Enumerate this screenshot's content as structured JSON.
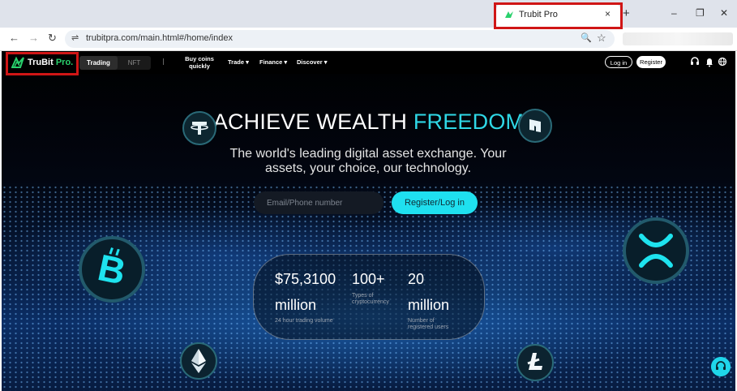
{
  "browser": {
    "tab_title": "Trubit Pro",
    "tab_close": "×",
    "new_tab": "+",
    "window_controls": {
      "minimize": "–",
      "restore": "❐",
      "close": "✕"
    },
    "nav": {
      "back": "←",
      "forward": "→",
      "reload": "↻"
    },
    "url": "trubitpra.com/main.html#/home/index",
    "site_info_icon": "⇌",
    "zoom_icon": "🔍",
    "bookmark_icon": "☆"
  },
  "header": {
    "logo_main": "TruBit",
    "logo_accent": " Pro.",
    "segments": [
      "Trading",
      "NFT"
    ],
    "buy_coins": "Buy coins quickly",
    "menu": [
      "Trade ▾",
      "Finance ▾",
      "Discover ▾"
    ],
    "login": "Log in",
    "register": "Register",
    "icons": [
      "headset-icon",
      "bell-icon",
      "globe-icon"
    ]
  },
  "hero": {
    "title_white": "ACHIEVE WEALTH ",
    "title_accent": "FREEDOM",
    "subtitle": "The world's leading digital asset exchange. Your assets, your choice, our technology.",
    "email_placeholder": "Email/Phone number",
    "cta": "Register/Log in"
  },
  "stats": [
    {
      "value": "$75,3100",
      "value2": "million",
      "label": "24 hour trading volume"
    },
    {
      "value": "100+",
      "label": "Types of cryptocurrency"
    },
    {
      "value": "20",
      "value2": "million",
      "label": "Number of registered users"
    }
  ],
  "coins": [
    "tether-icon",
    "nuls-icon",
    "bitcoin-icon",
    "xrp-icon",
    "ethereum-icon",
    "litecoin-icon"
  ],
  "colors": {
    "accent": "#2fd8e6",
    "logo_green": "#29d16c",
    "highlight": "#d01616"
  }
}
